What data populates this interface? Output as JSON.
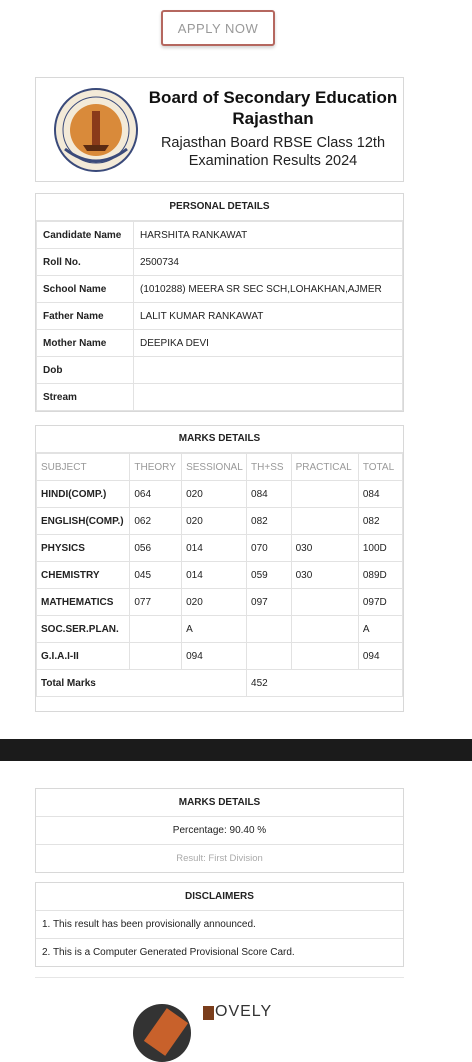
{
  "apply_button": "APPLY NOW",
  "header": {
    "title": "Board of Secondary Education Rajasthan",
    "subtitle": "Rajasthan Board RBSE Class 12th Examination Results 2024"
  },
  "personal": {
    "heading": "PERSONAL DETAILS",
    "rows": [
      {
        "label": "Candidate Name",
        "value": "HARSHITA RANKAWAT"
      },
      {
        "label": "Roll No.",
        "value": "2500734"
      },
      {
        "label": "School Name",
        "value": "(1010288) MEERA SR SEC SCH,LOHAKHAN,AJMER"
      },
      {
        "label": "Father Name",
        "value": "LALIT KUMAR RANKAWAT"
      },
      {
        "label": "Mother Name",
        "value": "DEEPIKA DEVI"
      },
      {
        "label": "Dob",
        "value": ""
      },
      {
        "label": "Stream",
        "value": ""
      }
    ]
  },
  "marks": {
    "heading": "MARKS DETAILS",
    "columns": [
      "SUBJECT",
      "THEORY",
      "SESSIONAL",
      "TH+SS",
      "PRACTICAL",
      "TOTAL"
    ],
    "rows": [
      [
        "HINDI(COMP.)",
        "064",
        "020",
        "084",
        "",
        "084"
      ],
      [
        "ENGLISH(COMP.)",
        "062",
        "020",
        "082",
        "",
        "082"
      ],
      [
        "PHYSICS",
        "056",
        "014",
        "070",
        "030",
        "100D"
      ],
      [
        "CHEMISTRY",
        "045",
        "014",
        "059",
        "030",
        "089D"
      ],
      [
        "MATHEMATICS",
        "077",
        "020",
        "097",
        "",
        "097D"
      ],
      [
        "SOC.SER.PLAN.",
        "",
        "A",
        "",
        "",
        "A"
      ],
      [
        "G.I.A.I-II",
        "",
        "094",
        "",
        "",
        "094"
      ]
    ],
    "total_label": "Total Marks",
    "total_value": "452"
  },
  "summary": {
    "heading": "MARKS DETAILS",
    "percentage": "Percentage: 90.40 %",
    "result": "Result: First Division"
  },
  "disclaimers": {
    "heading": "DISCLAIMERS",
    "items": [
      "1. This result has been provisionally announced.",
      "2. This is a Computer Generated Provisional Score Card."
    ]
  },
  "footer": {
    "brand": "OVELY"
  },
  "colors": {
    "button_border": "#b5675f",
    "band": "#1b1b1b"
  }
}
